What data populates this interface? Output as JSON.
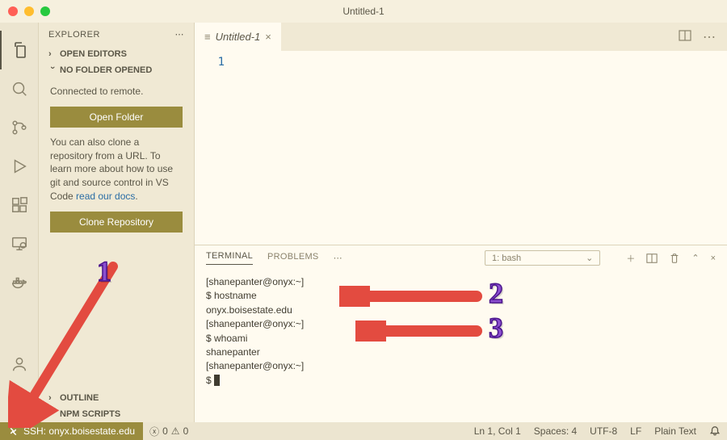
{
  "window": {
    "title": "Untitled-1"
  },
  "sidebar": {
    "title": "EXPLORER",
    "openEditors": "OPEN EDITORS",
    "noFolder": "NO FOLDER OPENED",
    "connected": "Connected to remote.",
    "openFolderBtn": "Open Folder",
    "cloneText1": "You can also clone a repository from a URL. To learn more about how to use git and source control in VS Code ",
    "docsLink": "read our docs",
    "cloneBtn": "Clone Repository",
    "outline": "OUTLINE",
    "npm": "NPM SCRIPTS"
  },
  "editor": {
    "tabName": "Untitled-1",
    "lineNumber": "1"
  },
  "panel": {
    "terminalTab": "TERMINAL",
    "problemsTab": "PROBLEMS",
    "selectLabel": "1: bash",
    "termLines": [
      "[shanepanter@onyx:~]",
      "$ hostname",
      "onyx.boisestate.edu",
      "[shanepanter@onyx:~]",
      "$ whoami",
      "shanepanter",
      "[shanepanter@onyx:~]",
      "$ "
    ]
  },
  "status": {
    "remote": "SSH: onyx.boisestate.edu",
    "errors": "0",
    "warnings": "0",
    "lineCol": "Ln 1, Col 1",
    "spaces": "Spaces: 4",
    "encoding": "UTF-8",
    "eol": "LF",
    "lang": "Plain Text"
  },
  "annotations": {
    "n1": "1",
    "n2": "2",
    "n3": "3"
  }
}
